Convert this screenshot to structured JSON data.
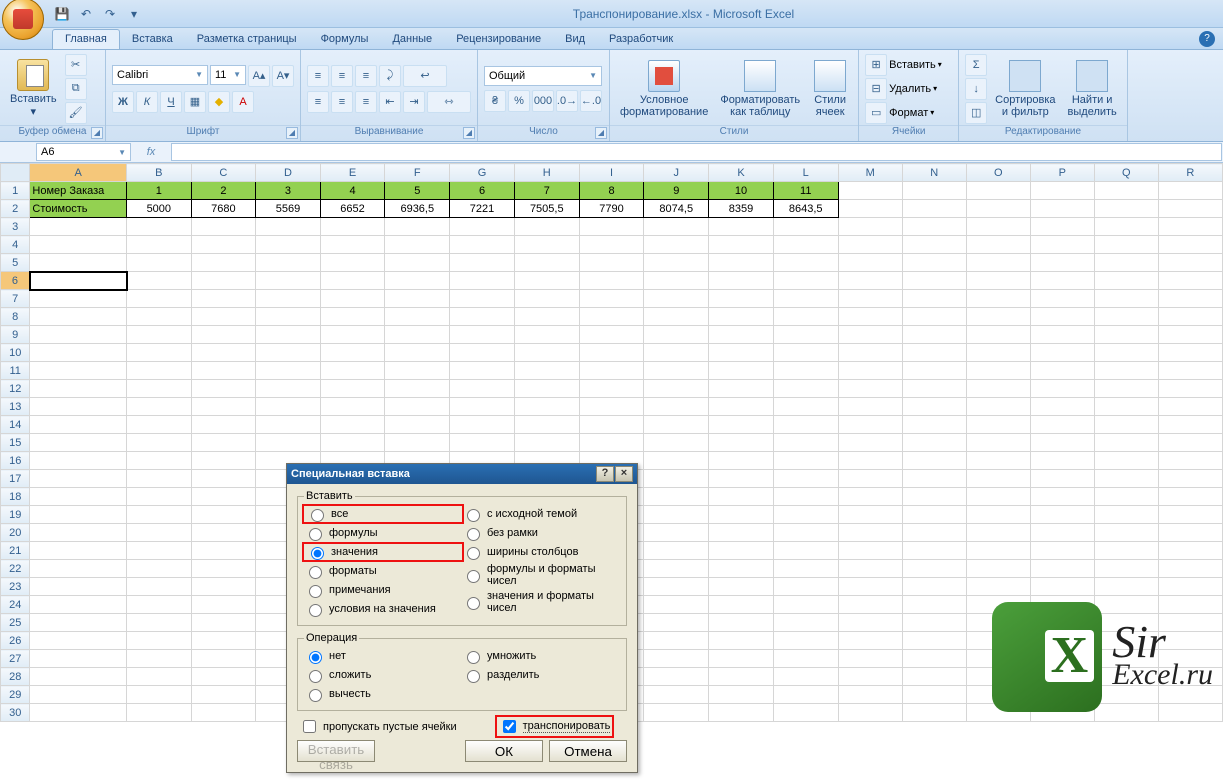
{
  "title": "Транспонирование.xlsx - Microsoft Excel",
  "qat": {
    "save": "💾",
    "undo": "↶",
    "redo": "↷"
  },
  "tabs": [
    "Главная",
    "Вставка",
    "Разметка страницы",
    "Формулы",
    "Данные",
    "Рецензирование",
    "Вид",
    "Разработчик"
  ],
  "active_tab": 0,
  "ribbon": {
    "clipboard": {
      "label": "Буфер обмена",
      "paste": "Вставить"
    },
    "font": {
      "label": "Шрифт",
      "name": "Calibri",
      "size": "11"
    },
    "align": {
      "label": "Выравнивание"
    },
    "number": {
      "label": "Число",
      "format": "Общий"
    },
    "styles": {
      "label": "Стили",
      "cond": "Условное\nформатирование",
      "table": "Форматировать\nкак таблицу",
      "cell": "Стили\nячеек"
    },
    "cells": {
      "label": "Ячейки",
      "insert": "Вставить",
      "delete": "Удалить",
      "format": "Формат"
    },
    "editing": {
      "label": "Редактирование",
      "sort": "Сортировка\nи фильтр",
      "find": "Найти и\nвыделить"
    }
  },
  "namebox": "A6",
  "columns": [
    "A",
    "B",
    "C",
    "D",
    "E",
    "F",
    "G",
    "H",
    "I",
    "J",
    "K",
    "L",
    "M",
    "N",
    "O",
    "P",
    "Q",
    "R"
  ],
  "rows": 30,
  "data": {
    "r1": {
      "A": "Номер Заказа",
      "B": "1",
      "C": "2",
      "D": "3",
      "E": "4",
      "F": "5",
      "G": "6",
      "H": "7",
      "I": "8",
      "J": "9",
      "K": "10",
      "L": "11"
    },
    "r2": {
      "A": "Стоимость",
      "B": "5000",
      "C": "7680",
      "D": "5569",
      "E": "6652",
      "F": "6936,5",
      "G": "7221",
      "H": "7505,5",
      "I": "7790",
      "J": "8074,5",
      "K": "8359",
      "L": "8643,5"
    }
  },
  "selected_cell": "A6",
  "dialog": {
    "title": "Специальная вставка",
    "group_paste": "Вставить",
    "paste_opts_left": [
      "все",
      "формулы",
      "значения",
      "форматы",
      "примечания",
      "условия на значения"
    ],
    "paste_opts_right": [
      "с исходной темой",
      "без рамки",
      "ширины столбцов",
      "формулы и форматы чисел",
      "значения и форматы чисел"
    ],
    "paste_selected": "значения",
    "group_op": "Операция",
    "op_left": [
      "нет",
      "сложить",
      "вычесть"
    ],
    "op_right": [
      "умножить",
      "разделить"
    ],
    "op_selected": "нет",
    "skip_blanks": "пропускать пустые ячейки",
    "transpose": "транспонировать",
    "transpose_checked": true,
    "link": "Вставить связь",
    "ok": "ОК",
    "cancel": "Отмена"
  },
  "watermark": {
    "line1": "Sir",
    "line2": "Excel.ru"
  }
}
